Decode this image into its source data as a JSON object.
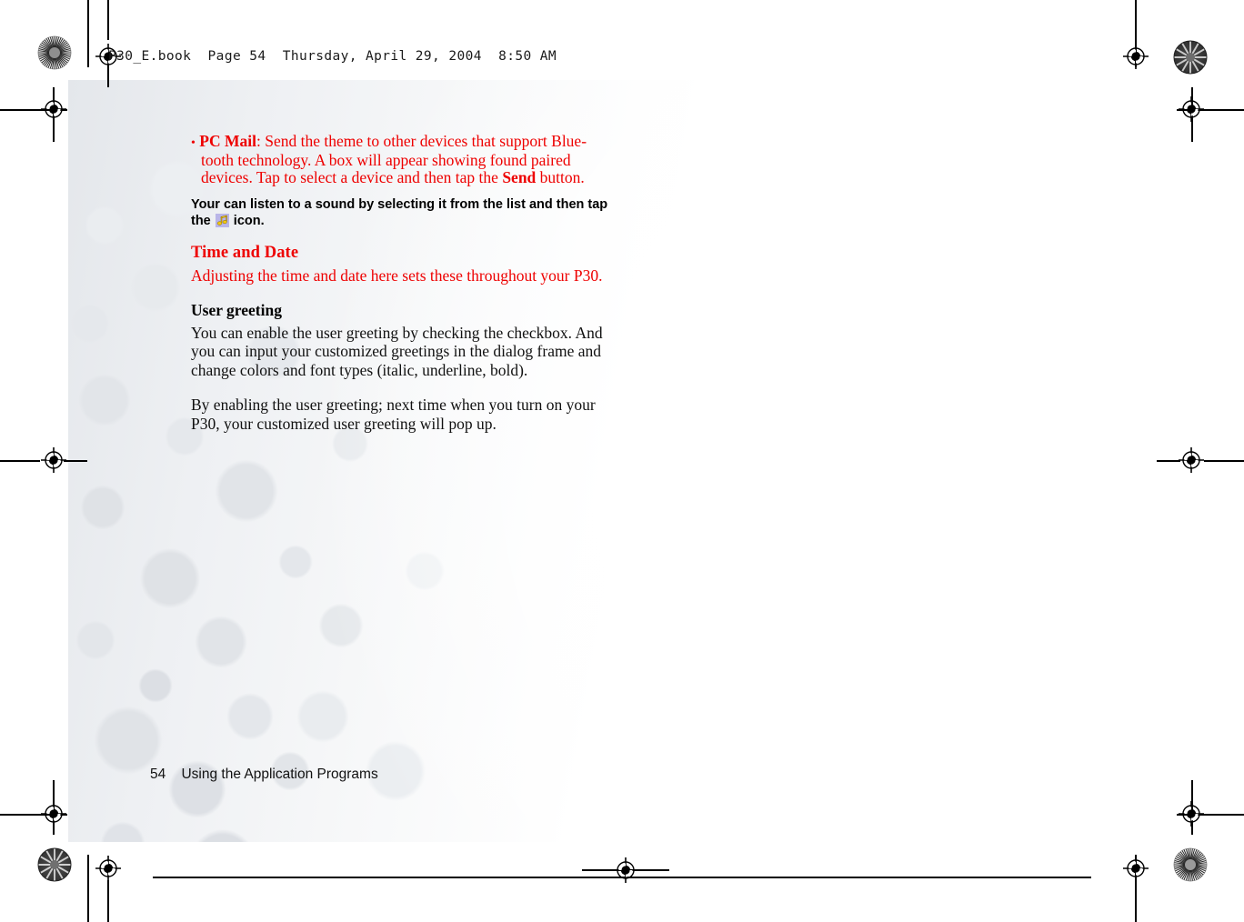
{
  "document": {
    "header_slug": "P30_E.book  Page 54  Thursday, April 29, 2004  8:50 AM",
    "footer_page_number": "54",
    "footer_chapter": "Using the Application Programs",
    "footer_line": "54    Using the Application Programs"
  },
  "colors": {
    "accent_red": "#ee0000",
    "body_black": "#111111",
    "icon_background": "#b9b5e8",
    "icon_note": "#f2c80f",
    "page_texture": "#e4e7eb"
  },
  "content": {
    "bullet": {
      "marker": "•",
      "term": "PC Mail",
      "after_term": ": Send the theme to other devices that support Blue-tooth technology. A box will appear showing found paired devices. Tap to select a device and then tap the ",
      "bold_word": "Send",
      "tail": " button."
    },
    "note": {
      "text_before_icon": "Your can listen to a sound by selecting it from the list and then tap the ",
      "icon_name": "music-note-icon",
      "text_after_icon": " icon."
    },
    "section_time_and_date": {
      "heading": "Time and Date",
      "paragraph": "Adjusting the time and date here sets these throughout your P30."
    },
    "section_user_greeting": {
      "heading": "User greeting",
      "paragraph_1": "You can enable the user greeting by checking the checkbox. And you can input your customized greetings in the dialog frame and change colors and font types (italic, underline, bold).",
      "paragraph_2": "By enabling the user greeting; next time when you turn on your P30, your customized user greeting will pop up."
    }
  },
  "printer_marks": {
    "registration_target_name": "registration-crosshair-mark",
    "star_target_name": "star-density-target",
    "trim_line_name": "trim-crop-line"
  }
}
